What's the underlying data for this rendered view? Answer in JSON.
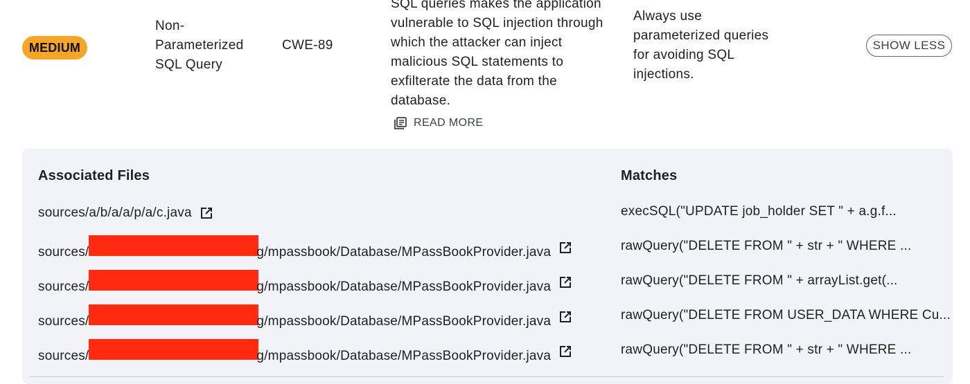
{
  "finding": {
    "severity": "MEDIUM",
    "severity_color": "#f5a623",
    "title": "Non-Parameterized SQL Query",
    "cwe": "CWE-89",
    "description": "SQL queries makes the application vulnerable to SQL injection through which the attacker can inject malicious SQL statements to exfilterate the data from the database.",
    "read_more_label": "READ MORE",
    "read_more_icon": "article-icon",
    "remediation": "Always use parameterized queries for avoiding SQL injections.",
    "show_less_label": "SHOW LESS"
  },
  "panel": {
    "files_header": "Associated Files",
    "matches_header": "Matches",
    "open_icon": "open-in-new-icon",
    "redaction_color": "#ff2a0f",
    "rows": [
      {
        "file_prefix": "sources/a/b/a/a/p/a/c.java",
        "redacted": false,
        "file_suffix": "",
        "match": "execSQL(\"UPDATE job_holder SET \" + a.g.f..."
      },
      {
        "file_prefix": "sources/",
        "redacted": true,
        "file_suffix": "g/mpassbook/Database/MPassBookProvider.java",
        "match": "rawQuery(\"DELETE FROM \" + str + \" WHERE ..."
      },
      {
        "file_prefix": "sources/",
        "redacted": true,
        "file_suffix": "g/mpassbook/Database/MPassBookProvider.java",
        "match": "rawQuery(\"DELETE FROM \" + arrayList.get(..."
      },
      {
        "file_prefix": "sources/",
        "redacted": true,
        "file_suffix": "g/mpassbook/Database/MPassBookProvider.java",
        "match": "rawQuery(\"DELETE FROM USER_DATA WHERE Cu..."
      },
      {
        "file_prefix": "sources/",
        "redacted": true,
        "file_suffix": "g/mpassbook/Database/MPassBookProvider.java",
        "match": "rawQuery(\"DELETE FROM \" + str + \" WHERE ..."
      }
    ]
  }
}
